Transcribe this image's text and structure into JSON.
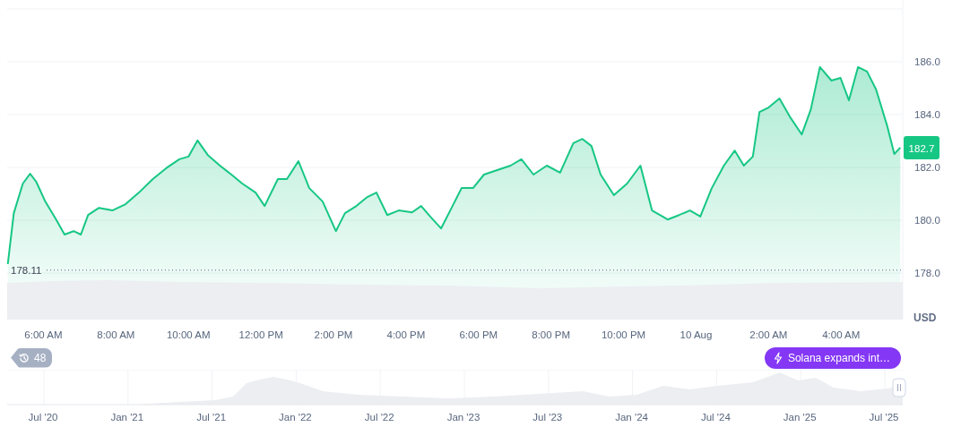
{
  "chart": {
    "chart_data": {
      "type": "area",
      "x": [
        "2025-08-09T05:01",
        "2025-08-09T05:11",
        "2025-08-09T05:26",
        "2025-08-09T05:38",
        "2025-08-09T05:48",
        "2025-08-09T06:03",
        "2025-08-09T06:21",
        "2025-08-09T06:35",
        "2025-08-09T06:50",
        "2025-08-09T07:02",
        "2025-08-09T07:14",
        "2025-08-09T07:32",
        "2025-08-09T07:54",
        "2025-08-09T08:16",
        "2025-08-09T08:38",
        "2025-08-09T09:01",
        "2025-08-09T09:23",
        "2025-08-09T09:45",
        "2025-08-09T10:00",
        "2025-08-09T10:15",
        "2025-08-09T10:32",
        "2025-08-09T10:52",
        "2025-08-09T11:11",
        "2025-08-09T11:29",
        "2025-08-09T11:51",
        "2025-08-09T12:06",
        "2025-08-09T12:28",
        "2025-08-09T12:43",
        "2025-08-09T13:02",
        "2025-08-09T13:20",
        "2025-08-09T13:42",
        "2025-08-09T14:04",
        "2025-08-09T14:19",
        "2025-08-09T14:38",
        "2025-08-09T14:56",
        "2025-08-09T15:11",
        "2025-08-09T15:29",
        "2025-08-09T15:48",
        "2025-08-09T16:10",
        "2025-08-09T16:25",
        "2025-08-09T16:40",
        "2025-08-09T16:58",
        "2025-08-09T17:17",
        "2025-08-09T17:32",
        "2025-08-09T17:51",
        "2025-08-09T18:09",
        "2025-08-09T18:31",
        "2025-08-09T18:53",
        "2025-08-09T19:11",
        "2025-08-09T19:31",
        "2025-08-09T19:53",
        "2025-08-09T20:15",
        "2025-08-09T20:37",
        "2025-08-09T20:52",
        "2025-08-09T21:07",
        "2025-08-09T21:22",
        "2025-08-09T21:44",
        "2025-08-09T22:06",
        "2025-08-09T22:28",
        "2025-08-09T22:47",
        "2025-08-09T23:13",
        "2025-08-09T23:32",
        "2025-08-09T23:50",
        "2025-08-10T00:07",
        "2025-08-10T00:26",
        "2025-08-10T00:46",
        "2025-08-10T01:04",
        "2025-08-10T01:19",
        "2025-08-10T01:34",
        "2025-08-10T01:45",
        "2025-08-10T02:00",
        "2025-08-10T02:18",
        "2025-08-10T02:35",
        "2025-08-10T02:55",
        "2025-08-10T03:10",
        "2025-08-10T03:25",
        "2025-08-10T03:44",
        "2025-08-10T03:59",
        "2025-08-10T04:13",
        "2025-08-10T04:28",
        "2025-08-10T04:43",
        "2025-08-10T04:58",
        "2025-08-10T05:16",
        "2025-08-10T05:28",
        "2025-08-10T05:38"
      ],
      "series": [
        {
          "color": "#16c784",
          "values": [
            178.34,
            180.27,
            181.39,
            181.76,
            181.46,
            180.71,
            180.03,
            179.46,
            179.59,
            179.46,
            180.2,
            180.47,
            180.37,
            180.61,
            181.05,
            181.56,
            181.97,
            182.31,
            182.41,
            183.02,
            182.47,
            182.07,
            181.73,
            181.39,
            181.05,
            180.54,
            181.56,
            181.56,
            182.24,
            181.22,
            180.71,
            179.59,
            180.27,
            180.54,
            180.88,
            181.05,
            180.2,
            180.37,
            180.3,
            180.54,
            180.14,
            179.69,
            180.54,
            181.22,
            181.22,
            181.73,
            181.9,
            182.07,
            182.31,
            181.73,
            182.07,
            181.8,
            182.92,
            183.08,
            182.81,
            181.73,
            180.95,
            181.39,
            182.07,
            180.37,
            180.03,
            180.2,
            180.37,
            180.14,
            181.22,
            182.07,
            182.64,
            182.07,
            182.41,
            184.1,
            184.27,
            184.61,
            183.93,
            183.25,
            184.2,
            185.8,
            185.29,
            185.39,
            184.54,
            185.8,
            185.63,
            184.95,
            183.59,
            182.51,
            182.75
          ]
        }
      ],
      "xlim": [
        "2025-08-09T05:00",
        "2025-08-10T05:42"
      ],
      "ylim": [
        176.24,
        188.0
      ],
      "xticks": [
        {
          "value": "2025-08-09T06:00",
          "label": "6:00 AM"
        },
        {
          "value": "2025-08-09T08:00",
          "label": "8:00 AM"
        },
        {
          "value": "2025-08-09T10:00",
          "label": "10:00 AM"
        },
        {
          "value": "2025-08-09T12:00",
          "label": "12:00 PM"
        },
        {
          "value": "2025-08-09T14:00",
          "label": "2:00 PM"
        },
        {
          "value": "2025-08-09T16:00",
          "label": "4:00 PM"
        },
        {
          "value": "2025-08-09T18:00",
          "label": "6:00 PM"
        },
        {
          "value": "2025-08-09T20:00",
          "label": "8:00 PM"
        },
        {
          "value": "2025-08-09T22:00",
          "label": "10:00 PM"
        },
        {
          "value": "2025-08-10T00:00",
          "label": "10 Aug"
        },
        {
          "value": "2025-08-10T02:00",
          "label": "2:00 AM"
        },
        {
          "value": "2025-08-10T04:00",
          "label": "4:00 AM"
        }
      ],
      "yticks": [
        {
          "value": 178,
          "label": "178.0"
        },
        {
          "value": 180,
          "label": "180.0"
        },
        {
          "value": 182,
          "label": "182.0"
        },
        {
          "value": 184,
          "label": "184.0"
        },
        {
          "value": 186,
          "label": "186.0"
        }
      ],
      "grid": true,
      "ref_lines": [
        {
          "axis": "y",
          "value": 178.11,
          "label": "178.11"
        }
      ]
    },
    "current_price": "182.7",
    "currency": "USD"
  },
  "events": {
    "count": "48"
  },
  "news": [
    {
      "label": "Solana expands int…"
    }
  ],
  "navigator": {
    "labels": [
      "Jul '20",
      "Jan '21",
      "Jul '21",
      "Jan '22",
      "Jul '22",
      "Jan '23",
      "Jul '23",
      "Jan '24",
      "Jul '24",
      "Jan '25",
      "Jul '25"
    ]
  }
}
